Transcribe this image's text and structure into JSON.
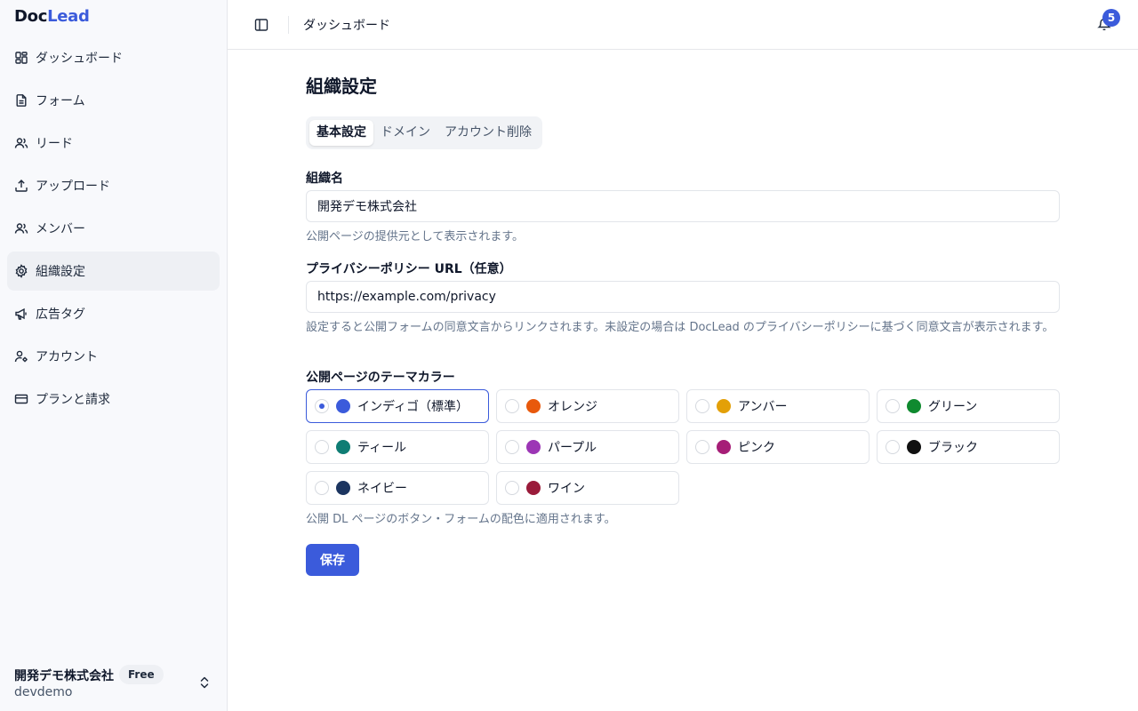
{
  "app": {
    "logo_part1": "Doc",
    "logo_part2": "Lead"
  },
  "sidebar": {
    "items": [
      {
        "label": "ダッシュボード",
        "icon": "dashboard-icon"
      },
      {
        "label": "フォーム",
        "icon": "file-text-icon"
      },
      {
        "label": "リード",
        "icon": "users-icon"
      },
      {
        "label": "アップロード",
        "icon": "upload-icon"
      },
      {
        "label": "メンバー",
        "icon": "users-icon"
      },
      {
        "label": "組織設定",
        "icon": "gear-icon",
        "active": true
      },
      {
        "label": "広告タグ",
        "icon": "megaphone-icon"
      },
      {
        "label": "アカウント",
        "icon": "user-cog-icon"
      },
      {
        "label": "プランと請求",
        "icon": "credit-card-icon"
      }
    ],
    "org": {
      "name": "開発デモ株式会社",
      "plan": "Free",
      "slug": "devdemo"
    }
  },
  "header": {
    "breadcrumb": "ダッシュボード",
    "notification_count": "5"
  },
  "main": {
    "title": "組織設定",
    "tabs": [
      {
        "label": "基本設定",
        "active": true
      },
      {
        "label": "ドメイン"
      },
      {
        "label": "アカウント削除"
      }
    ],
    "org_name": {
      "label": "組織名",
      "value": "開発デモ株式会社",
      "help": "公開ページの提供元として表示されます。"
    },
    "privacy": {
      "label": "プライバシーポリシー URL（任意）",
      "value": "https://example.com/privacy",
      "help": "設定すると公開フォームの同意文言からリンクされます。未設定の場合は DocLead のプライバシーポリシーに基づく同意文言が表示されます。"
    },
    "theme": {
      "label": "公開ページのテーマカラー",
      "options": [
        {
          "name": "インディゴ（標準）",
          "color": "#3b5bdb",
          "selected": true
        },
        {
          "name": "オレンジ",
          "color": "#e8590c"
        },
        {
          "name": "アンバー",
          "color": "#e3a008"
        },
        {
          "name": "グリーン",
          "color": "#0f8a2f"
        },
        {
          "name": "ティール",
          "color": "#0f7d74"
        },
        {
          "name": "パープル",
          "color": "#9c36b5"
        },
        {
          "name": "ピンク",
          "color": "#a61e77"
        },
        {
          "name": "ブラック",
          "color": "#111111"
        },
        {
          "name": "ネイビー",
          "color": "#1c3560"
        },
        {
          "name": "ワイン",
          "color": "#9a1b3a"
        }
      ],
      "help": "公開 DL ページのボタン・フォームの配色に適用されます。"
    },
    "save_label": "保存"
  },
  "colors": {
    "accent": "#3b5bdb",
    "sidebar_bg": "#f8f9fc",
    "active_nav_bg": "#eef0f4"
  }
}
